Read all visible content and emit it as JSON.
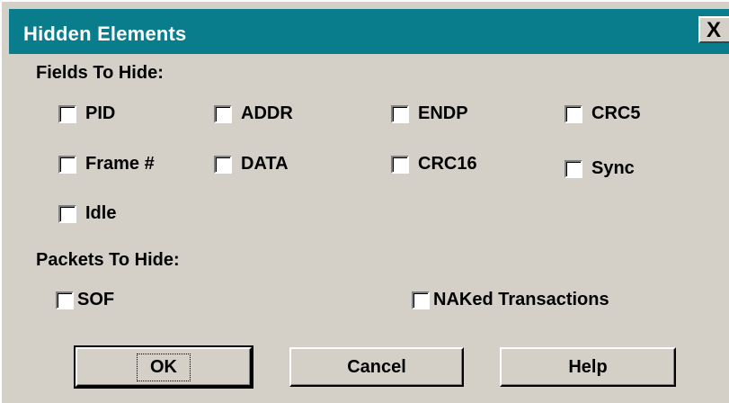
{
  "dialog": {
    "title": "Hidden Elements",
    "close_label": "X"
  },
  "fields_section": {
    "label": "Fields To Hide:",
    "checkboxes": [
      {
        "label": "PID",
        "checked": false
      },
      {
        "label": "ADDR",
        "checked": false
      },
      {
        "label": "ENDP",
        "checked": false
      },
      {
        "label": "CRC5",
        "checked": false
      },
      {
        "label": "Frame #",
        "checked": false
      },
      {
        "label": "DATA",
        "checked": false
      },
      {
        "label": "CRC16",
        "checked": false
      },
      {
        "label": "Sync",
        "checked": false
      },
      {
        "label": "Idle",
        "checked": false
      }
    ]
  },
  "packets_section": {
    "label": "Packets To Hide:",
    "checkboxes": [
      {
        "label": "SOF",
        "checked": false
      },
      {
        "label": "NAKed Transactions",
        "checked": false
      }
    ]
  },
  "buttons": {
    "ok": "OK",
    "cancel": "Cancel",
    "help": "Help"
  }
}
